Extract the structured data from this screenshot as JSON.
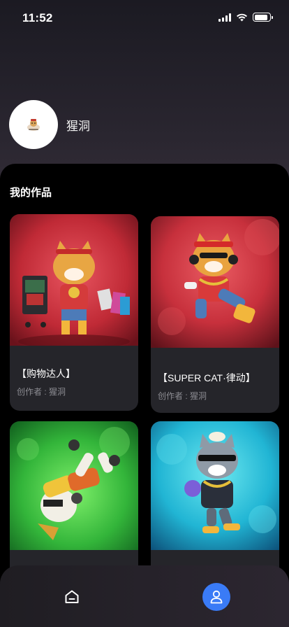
{
  "status_bar": {
    "time": "11:52",
    "battery_level": 0.9
  },
  "profile": {
    "avatar_icon": "cat-avatar-icon",
    "username": "猩洞"
  },
  "section": {
    "title": "我的作品"
  },
  "works": [
    {
      "title": "【购物达人】",
      "author": "创作者 : 猩洞",
      "theme": "red"
    },
    {
      "title": "【SUPER CAT·律动】",
      "author": "创作者 : 猩洞",
      "theme": "red"
    },
    {
      "title": "",
      "author": "",
      "theme": "green"
    },
    {
      "title": "",
      "author": "",
      "theme": "cyan"
    }
  ],
  "tabbar": {
    "home_icon": "home-icon",
    "profile_icon": "user-icon",
    "accent_color": "#3a7bf6"
  }
}
